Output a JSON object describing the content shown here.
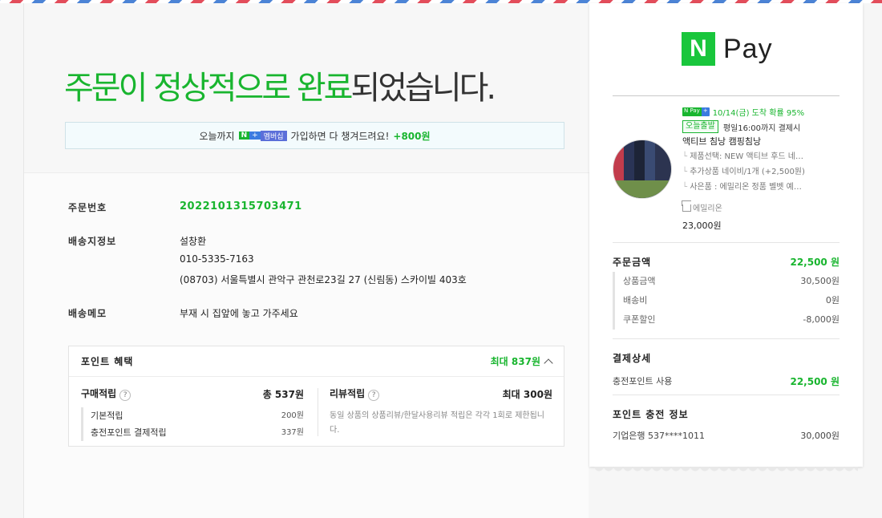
{
  "headline": {
    "part1": "주문이 정상적으로 완료",
    "part2": "되었습니다."
  },
  "promo": {
    "prefix": "오늘까지",
    "badge_n": "N",
    "badge_plus": "+",
    "badge_member": "멤버십",
    "text": "가입하면 다 챙겨드려요!",
    "bonus": "+800원"
  },
  "order": {
    "number_label": "주문번호",
    "number": "2022101315703471",
    "shipping_label": "배송지정보",
    "recipient": "설창환",
    "phone": "010-5335-7163",
    "address": "(08703) 서울특별시 관악구 관천로23길 27 (신림동) 스카이빌 403호",
    "memo_label": "배송메모",
    "memo": "부재 시 집앞에 놓고 가주세요"
  },
  "points": {
    "title": "포인트 혜택",
    "max": "최대 837원",
    "purchase": {
      "label": "구매적립",
      "help": "?",
      "total": "총 537원",
      "items": [
        {
          "label": "기본적립",
          "value": "200원"
        },
        {
          "label": "충전포인트 결제적립",
          "value": "337원"
        }
      ]
    },
    "review": {
      "label": "리뷰적립",
      "help": "?",
      "total": "최대 300원",
      "desc": "동일 상품의 상품리뷰/한달사용리뷰 적립은 각각 1회로 제한됩니다."
    }
  },
  "receipt": {
    "logo_n": "N",
    "logo_pay": "Pay",
    "product": {
      "mini_n": "N Pay",
      "mini_plus": "+",
      "delivery": "10/14(금) 도착 확률 95%",
      "today_badge": "오늘출발",
      "today_text": "평일16:00까지 결제시",
      "name": "액티브 침낭 캠핑침낭",
      "options": [
        "제품선택: NEW 액티브 후드 네…",
        "추가상품 네이비/1개 (+2,500원)",
        "사은품 : 에밀리온 정품 벨벳 예…"
      ],
      "seller": "에밀리온",
      "price": "23,000원"
    },
    "order_amount": {
      "label": "주문금액",
      "total": "22,500 원",
      "items": [
        {
          "label": "상품금액",
          "value": "30,500원"
        },
        {
          "label": "배송비",
          "value": "0원"
        },
        {
          "label": "쿠폰할인",
          "value": "-8,000원"
        }
      ]
    },
    "payment": {
      "label": "결제상세",
      "method": "충전포인트 사용",
      "amount": "22,500 원"
    },
    "charge": {
      "label": "포인트 충전 정보",
      "account": "기업은행 537****1011",
      "amount": "30,000원"
    }
  },
  "colors": {
    "accent_green": "#19b52f",
    "npay_green": "#19c63c",
    "plus_blue": "#3b7be0"
  }
}
